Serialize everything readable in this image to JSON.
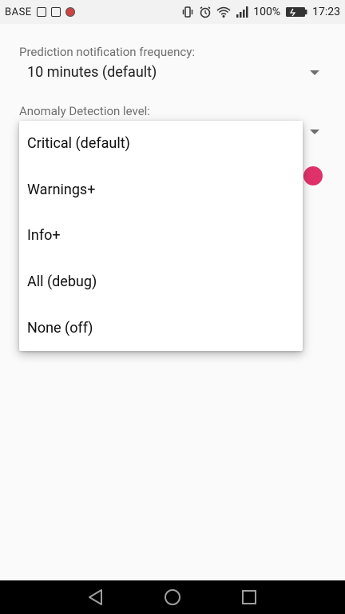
{
  "status_bar": {
    "carrier": "BASE",
    "battery_percent": "100%",
    "time": "17:23",
    "icons": [
      "vibrate-icon",
      "alarm-icon",
      "wifi-icon",
      "signal-icon",
      "battery-icon"
    ]
  },
  "settings": {
    "prediction": {
      "label": "Prediction notification frequency:",
      "value": "10 minutes (default)"
    },
    "anomaly": {
      "label": "Anomaly Detection level:"
    }
  },
  "popup": {
    "options": [
      "Critical (default)",
      "Warnings+",
      "Info+",
      "All (debug)",
      "None (off)"
    ]
  },
  "colors": {
    "accent": "#e0316b",
    "background": "#fafafa",
    "nav_bar": "#000000"
  },
  "nav_bar": {
    "buttons": [
      "back-icon",
      "home-icon",
      "recents-icon"
    ]
  }
}
